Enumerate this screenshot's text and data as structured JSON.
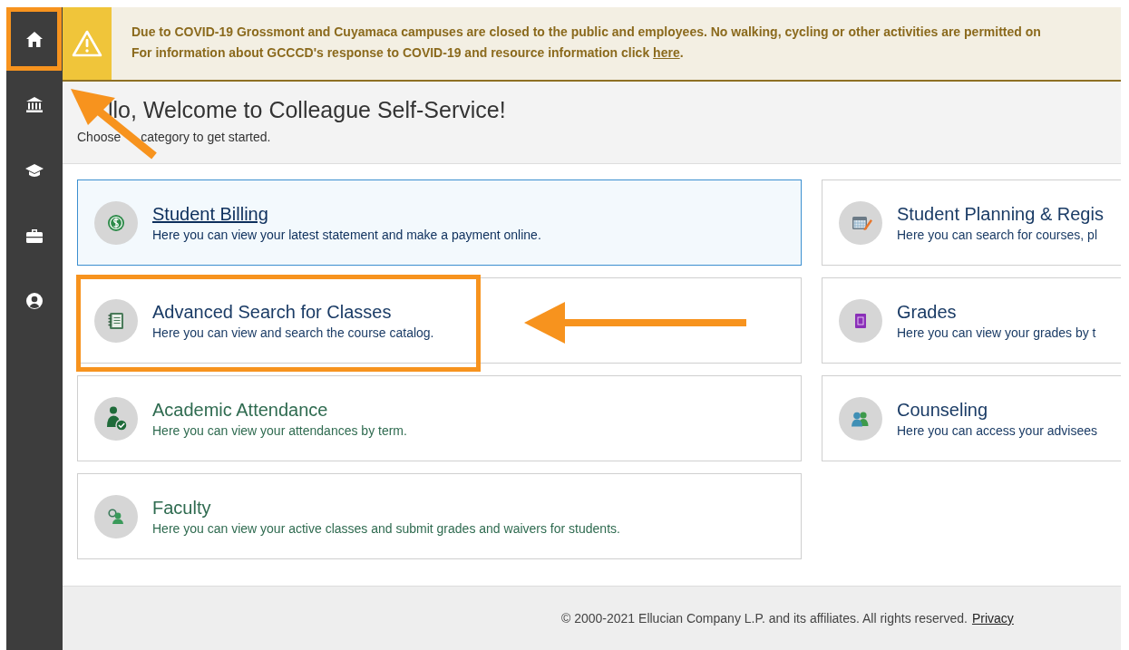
{
  "alert": {
    "line_1": "Due to COVID-19 Grossmont and Cuyamaca campuses are closed to the public and employees. No walking, cycling or other activities are permitted on",
    "line_2_text": "For information about GCCCD's response to COVID-19 and resource information click",
    "link": "here",
    "line_2_end": "."
  },
  "header": {
    "title": "llo, Welcome to Colleague Self-Service!",
    "subtitle_start": "Choose",
    "subtitle_end": "category to get started."
  },
  "categories": [
    {
      "title": "Student Billing",
      "description": "Here you can view your latest statement and make a payment online.",
      "selected": true,
      "color": "#0d2f5c"
    },
    {
      "title": "Student Planning & Regis",
      "description": "Here you can search for courses, pl",
      "selected": false,
      "color": "#1b3c66"
    },
    {
      "title": "Advanced Search for Classes",
      "description": "Here you can view and search the course catalog.",
      "selected": false,
      "color": "#1b3c66"
    },
    {
      "title": "Grades",
      "description": "Here you can view your grades by t",
      "selected": false,
      "color": "#1b3c66"
    },
    {
      "title": "Academic Attendance",
      "description": "Here you can view your attendances by term.",
      "selected": false,
      "color": "#2f6b50"
    },
    {
      "title": "Counseling",
      "description": "Here you can access your advisees",
      "selected": false,
      "color": "#1b3c66"
    },
    {
      "title": "Faculty",
      "description": "Here you can view your active classes and submit grades and waivers for students.",
      "selected": false,
      "color": "#2f6b50"
    }
  ],
  "footer": {
    "text": "© 2000-2021 Ellucian Company L.P. and its affiliates. All rights reserved.",
    "link": "Privacy"
  }
}
